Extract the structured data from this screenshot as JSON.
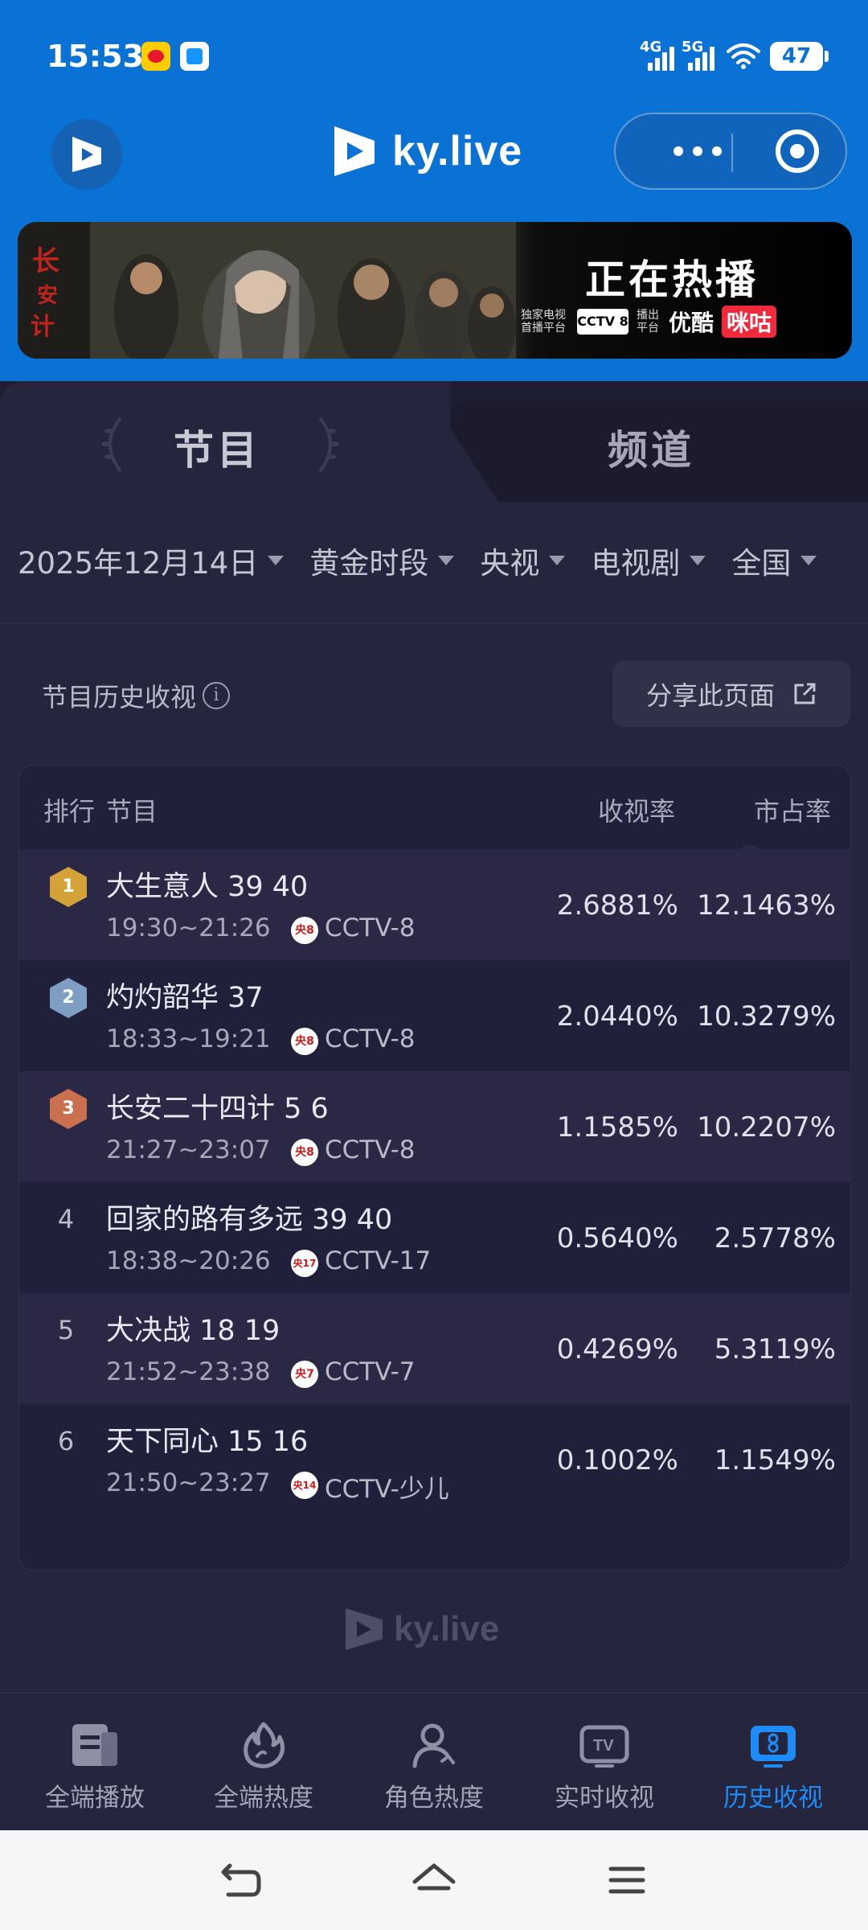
{
  "status_bar": {
    "time": "15:53",
    "network_1": "4G",
    "network_2": "5G",
    "battery": "47"
  },
  "header": {
    "brand": "ky.live"
  },
  "banner": {
    "title": "正在热播",
    "exclusive_label": "独家电视首播平台",
    "cctv_label": "CCTV 8",
    "broadcast_label": "播出平台",
    "youku": "优酷",
    "migu": "咪咕"
  },
  "tabs": {
    "program": "节目",
    "channel": "频道"
  },
  "filters": {
    "date": "2025年12月14日",
    "slot": "黄金时段",
    "network": "央视",
    "genre": "电视剧",
    "region": "全国"
  },
  "section": {
    "title": "节目历史收视",
    "share_button": "分享此页面"
  },
  "table": {
    "headers": {
      "rank": "排行",
      "program": "节目",
      "rating": "收视率",
      "share": "市占率"
    },
    "rows": [
      {
        "rank": "1",
        "name": "大生意人 39 40",
        "time": "19:30~21:26",
        "channel_badge": "央8",
        "channel": "CCTV-8",
        "rating": "2.6881%",
        "share": "12.1463%"
      },
      {
        "rank": "2",
        "name": "灼灼韶华 37",
        "time": "18:33~19:21",
        "channel_badge": "央8",
        "channel": "CCTV-8",
        "rating": "2.0440%",
        "share": "10.3279%"
      },
      {
        "rank": "3",
        "name": "长安二十四计 5 6",
        "time": "21:27~23:07",
        "channel_badge": "央8",
        "channel": "CCTV-8",
        "rating": "1.1585%",
        "share": "10.2207%"
      },
      {
        "rank": "4",
        "name": "回家的路有多远 39 40",
        "time": "18:38~20:26",
        "channel_badge": "央17",
        "channel": "CCTV-17",
        "rating": "0.5640%",
        "share": "2.5778%"
      },
      {
        "rank": "5",
        "name": "大决战 18 19",
        "time": "21:52~23:38",
        "channel_badge": "央7",
        "channel": "CCTV-7",
        "rating": "0.4269%",
        "share": "5.3119%"
      },
      {
        "rank": "6",
        "name": "天下同心 15 16",
        "time": "21:50~23:27",
        "channel_badge": "央14",
        "channel": "CCTV-少儿",
        "rating": "0.1002%",
        "share": "1.1549%"
      }
    ]
  },
  "footer_brand": "ky.live",
  "bottom_nav": [
    {
      "label": "全端播放",
      "icon": "play-card-icon"
    },
    {
      "label": "全端热度",
      "icon": "flame-icon"
    },
    {
      "label": "角色热度",
      "icon": "person-icon"
    },
    {
      "label": "实时收视",
      "icon": "tv-icon"
    },
    {
      "label": "历史收视",
      "icon": "history-tv-icon"
    }
  ],
  "colors": {
    "header_blue": "#0a72d4",
    "panel_dark": "#25253d",
    "active_blue": "#1d8cf8",
    "gold": "#d4a338",
    "silver": "#7e9ec4",
    "bronze": "#c9714e"
  }
}
